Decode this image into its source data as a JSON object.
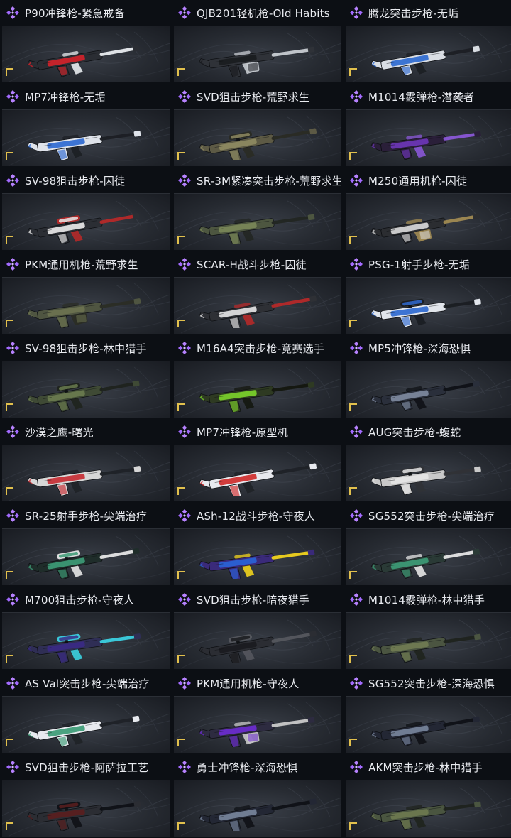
{
  "gallery": {
    "items": [
      {
        "title": "P90冲锋枪-紧急戒备",
        "icon": "assault-gun-icon",
        "accent": "#d2232a",
        "base": "#2a2d33",
        "trim": "#e9ecef"
      },
      {
        "title": "QJB201轻机枪-Old Habits",
        "icon": "light-machine-gun-icon",
        "accent": "#1a1c20",
        "base": "#2f3238",
        "trim": "#c8ccd2"
      },
      {
        "title": "腾龙突击步枪-无垢",
        "icon": "assault-rifle-icon",
        "accent": "#2f6ad0",
        "base": "#d9dde3",
        "trim": "#1c1f24"
      },
      {
        "title": "MP7冲锋枪-无垢",
        "icon": "smg-icon",
        "accent": "#2f6ad0",
        "base": "#dfe3ea",
        "trim": "#1c1f24"
      },
      {
        "title": "SVD狙击步枪-荒野求生",
        "icon": "sniper-rifle-icon",
        "accent": "#8e8a62",
        "base": "#5d5a45",
        "trim": "#2a2b24"
      },
      {
        "title": "M1014霰弹枪-潜袭者",
        "icon": "shotgun-icon",
        "accent": "#6d36b7",
        "base": "#2a1f39",
        "trim": "#8a57d7"
      },
      {
        "title": "SV-98狙击步枪-囚徒",
        "icon": "sniper-rifle-icon",
        "accent": "#e8e8e8",
        "base": "#2b2e34",
        "trim": "#b52929"
      },
      {
        "title": "SR-3M紧凑突击步枪-荒野求生",
        "icon": "assault-rifle-icon",
        "accent": "#7a8758",
        "base": "#4d5640",
        "trim": "#222622"
      },
      {
        "title": "M250通用机枪-囚徒",
        "icon": "machine-gun-icon",
        "accent": "#d8d8d8",
        "base": "#2b2d31",
        "trim": "#a08a52"
      },
      {
        "title": "PKM通用机枪-荒野求生",
        "icon": "machine-gun-icon",
        "accent": "#6c7350",
        "base": "#4f5541",
        "trim": "#2b2d25"
      },
      {
        "title": "SCAR-H战斗步枪-囚徒",
        "icon": "battle-rifle-icon",
        "accent": "#e3e3e3",
        "base": "#2e3035",
        "trim": "#b52929"
      },
      {
        "title": "PSG-1射手步枪-无垢",
        "icon": "marksman-rifle-icon",
        "accent": "#2f6ad0",
        "base": "#e1e5eb",
        "trim": "#1a1d22"
      },
      {
        "title": "SV-98狙击步枪-林中猎手",
        "icon": "sniper-rifle-icon",
        "accent": "#6a7b4f",
        "base": "#3f4a35",
        "trim": "#1f231d"
      },
      {
        "title": "M16A4突击步枪-竞赛选手",
        "icon": "assault-rifle-icon",
        "accent": "#7bd12b",
        "base": "#2e3a22",
        "trim": "#14170f"
      },
      {
        "title": "MP5冲锋枪-深海恐惧",
        "icon": "smg-icon",
        "accent": "#7e8aa0",
        "base": "#2a2f3b",
        "trim": "#0f1116"
      },
      {
        "title": "沙漠之鹰-曙光",
        "icon": "pistol-icon",
        "accent": "#c72e34",
        "base": "#d7d7d7",
        "trim": "#1f2227"
      },
      {
        "title": "MP7冲锋枪-原型机",
        "icon": "smg-icon",
        "accent": "#cf2d2d",
        "base": "#e7e9ee",
        "trim": "#1f2227"
      },
      {
        "title": "AUG突击步枪-蝮蛇",
        "icon": "bullpup-rifle-icon",
        "accent": "#e5e5e5",
        "base": "#c9c9c9",
        "trim": "#303236"
      },
      {
        "title": "SR-25射手步枪-尖端治疗",
        "icon": "marksman-rifle-icon",
        "accent": "#3d9b76",
        "base": "#1f2d2a",
        "trim": "#e6e6e6"
      },
      {
        "title": "ASh-12战斗步枪-守夜人",
        "icon": "battle-rifle-icon",
        "accent": "#2a63d6",
        "base": "#3a2a7a",
        "trim": "#f1d31d"
      },
      {
        "title": "SG552突击步枪-尖端治疗",
        "icon": "assault-rifle-icon",
        "accent": "#3d9b76",
        "base": "#2a3a36",
        "trim": "#e6e6e6"
      },
      {
        "title": "M700狙击步枪-守夜人",
        "icon": "sniper-rifle-icon",
        "accent": "#3b2a86",
        "base": "#2f2e55",
        "trim": "#3bd0e0"
      },
      {
        "title": "SVD狙击步枪-暗夜猎手",
        "icon": "sniper-rifle-icon",
        "accent": "#1a1b1f",
        "base": "#2b2d33",
        "trim": "#55575e"
      },
      {
        "title": "M1014霰弹枪-林中猎手",
        "icon": "shotgun-icon",
        "accent": "#707c52",
        "base": "#4b5541",
        "trim": "#1f231d"
      },
      {
        "title": "AS Val突击步枪-尖端治疗",
        "icon": "assault-rifle-icon",
        "accent": "#3d9b76",
        "base": "#e7e9ee",
        "trim": "#1f2227"
      },
      {
        "title": "PKM通用机枪-守夜人",
        "icon": "machine-gun-icon",
        "accent": "#6d2dd0",
        "base": "#2d2b40",
        "trim": "#c9c9c9"
      },
      {
        "title": "SG552突击步枪-深海恐惧",
        "icon": "assault-rifle-icon",
        "accent": "#77849b",
        "base": "#232734",
        "trim": "#0f1116"
      },
      {
        "title": "SVD狙击步枪-阿萨拉工艺",
        "icon": "sniper-rifle-icon",
        "accent": "#5a1e1e",
        "base": "#2b2d33",
        "trim": "#0f1116"
      },
      {
        "title": "勇士冲锋枪-深海恐惧",
        "icon": "smg-icon",
        "accent": "#77849b",
        "base": "#232734",
        "trim": "#0f1116"
      },
      {
        "title": "AKM突击步枪-林中猎手",
        "icon": "assault-rifle-icon",
        "accent": "#6d7a4f",
        "base": "#4a5540",
        "trim": "#1f231d"
      }
    ]
  }
}
